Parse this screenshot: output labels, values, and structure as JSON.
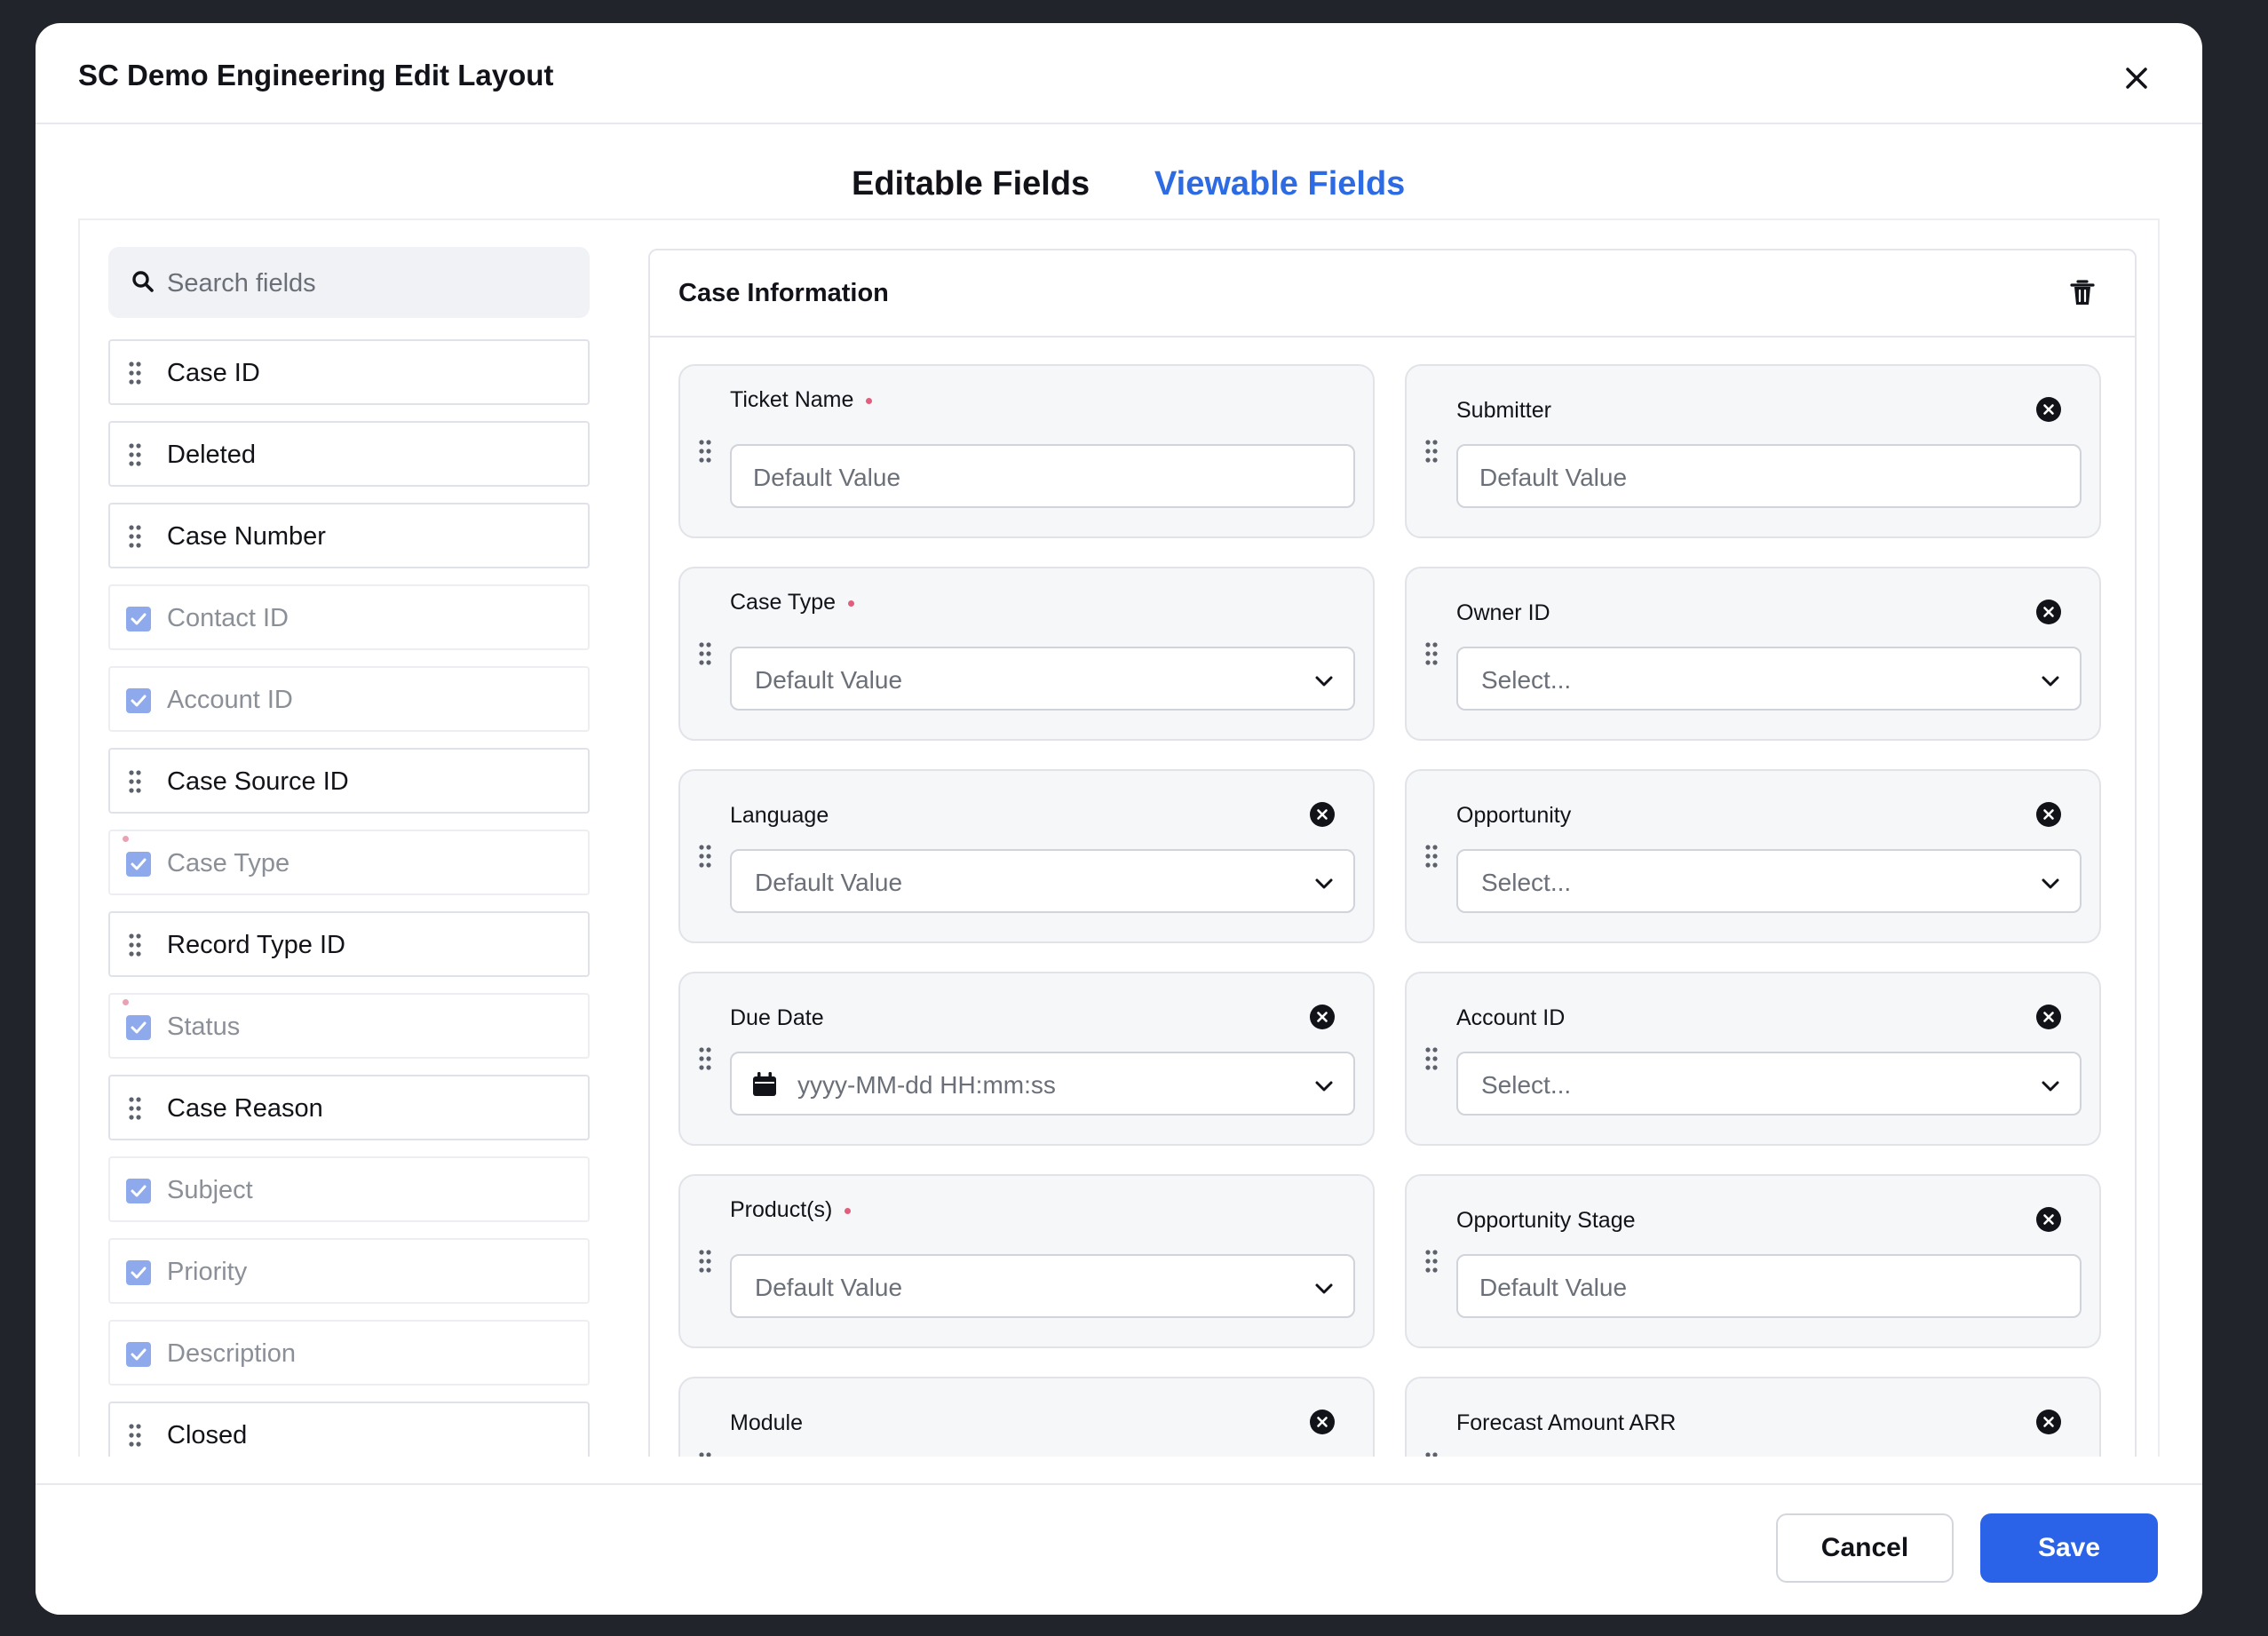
{
  "modal": {
    "title": "SC Demo Engineering Edit Layout",
    "close_icon": "close-icon"
  },
  "tabs": [
    {
      "label": "Editable Fields",
      "active": false
    },
    {
      "label": "Viewable Fields",
      "active": true
    }
  ],
  "sidebar": {
    "search_placeholder": "Search fields",
    "items": [
      {
        "label": "Case ID",
        "state": "draggable",
        "required": false
      },
      {
        "label": "Deleted",
        "state": "draggable",
        "required": false
      },
      {
        "label": "Case Number",
        "state": "draggable",
        "required": false
      },
      {
        "label": "Contact ID",
        "state": "checked",
        "required": false
      },
      {
        "label": "Account ID",
        "state": "checked",
        "required": false
      },
      {
        "label": "Case Source ID",
        "state": "draggable",
        "required": false
      },
      {
        "label": "Case Type",
        "state": "checked",
        "required": true
      },
      {
        "label": "Record Type ID",
        "state": "draggable",
        "required": false
      },
      {
        "label": "Status",
        "state": "checked",
        "required": true
      },
      {
        "label": "Case Reason",
        "state": "draggable",
        "required": false
      },
      {
        "label": "Subject",
        "state": "checked",
        "required": false
      },
      {
        "label": "Priority",
        "state": "checked",
        "required": false
      },
      {
        "label": "Description",
        "state": "checked",
        "required": false
      },
      {
        "label": "Closed",
        "state": "draggable",
        "required": false
      }
    ]
  },
  "section": {
    "title": "Case Information",
    "fields": [
      {
        "label": "Ticket Name",
        "required": true,
        "removable": false,
        "input": "text",
        "placeholder": "Default Value"
      },
      {
        "label": "Submitter",
        "required": false,
        "removable": true,
        "input": "text",
        "placeholder": "Default Value"
      },
      {
        "label": "Case Type",
        "required": true,
        "removable": false,
        "input": "select",
        "placeholder": "Default Value"
      },
      {
        "label": "Owner ID",
        "required": false,
        "removable": true,
        "input": "select",
        "placeholder": "Select..."
      },
      {
        "label": "Language",
        "required": false,
        "removable": true,
        "input": "select",
        "placeholder": "Default Value"
      },
      {
        "label": "Opportunity",
        "required": false,
        "removable": true,
        "input": "select",
        "placeholder": "Select..."
      },
      {
        "label": "Due Date",
        "required": false,
        "removable": true,
        "input": "date",
        "placeholder": "yyyy-MM-dd HH:mm:ss"
      },
      {
        "label": "Account ID",
        "required": false,
        "removable": true,
        "input": "select",
        "placeholder": "Select..."
      },
      {
        "label": "Product(s)",
        "required": true,
        "removable": false,
        "input": "select",
        "placeholder": "Default Value"
      },
      {
        "label": "Opportunity Stage",
        "required": false,
        "removable": true,
        "input": "text",
        "placeholder": "Default Value"
      },
      {
        "label": "Module",
        "required": false,
        "removable": true,
        "input": "none",
        "placeholder": ""
      },
      {
        "label": "Forecast Amount ARR",
        "required": false,
        "removable": true,
        "input": "none",
        "placeholder": ""
      }
    ]
  },
  "footer": {
    "cancel_label": "Cancel",
    "save_label": "Save"
  },
  "colors": {
    "accent": "#2b63e8",
    "active_tab": "#2d6be4",
    "required_dot": "#e35d7c",
    "checkbox": "#8ea9ec"
  }
}
